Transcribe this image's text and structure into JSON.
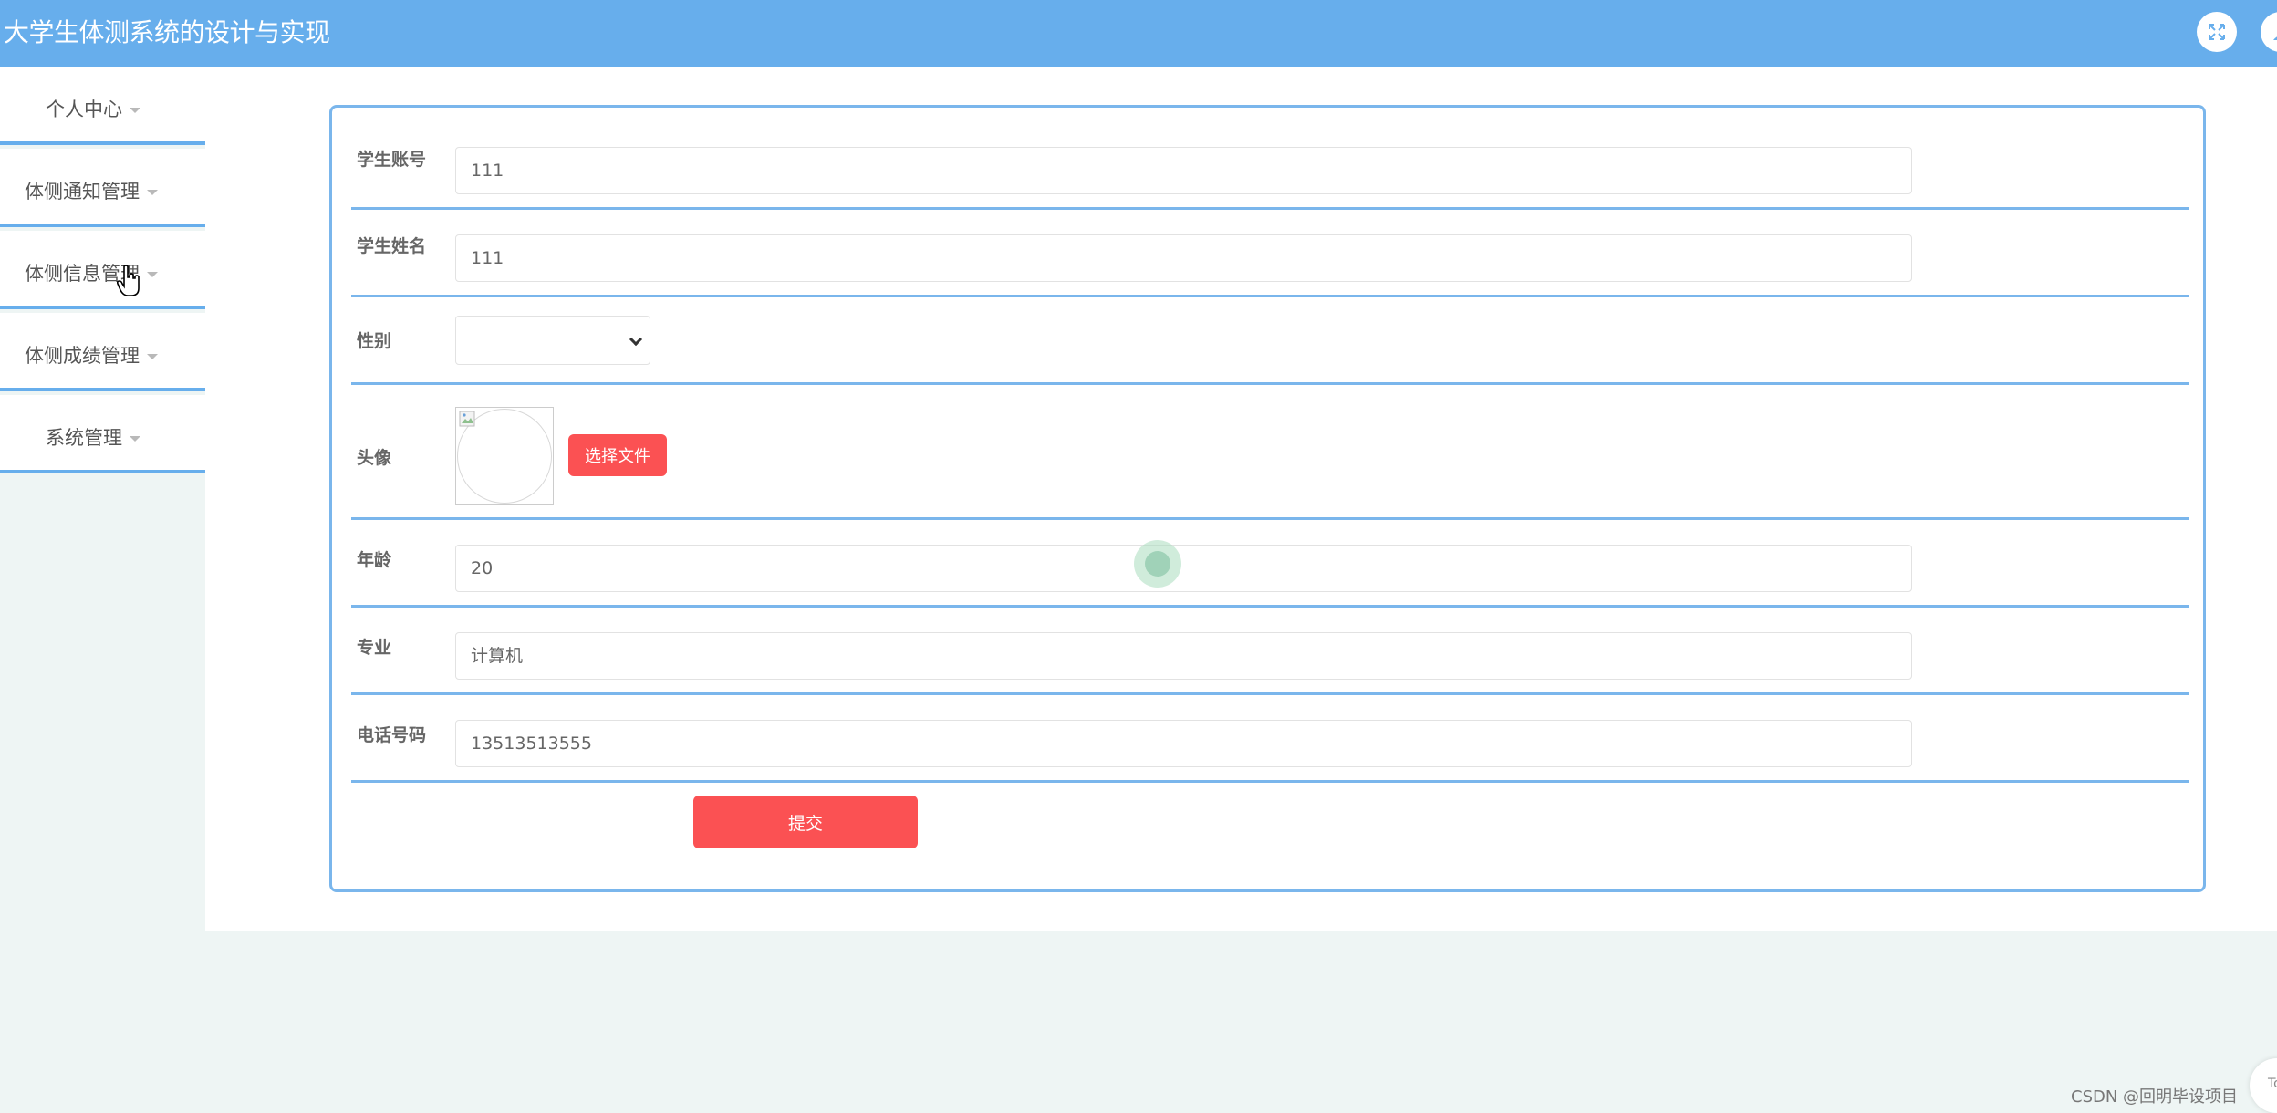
{
  "header": {
    "title": "大学生体测系统的设计与实现",
    "fullscreen_icon": "fullscreen-icon",
    "user_icon": "user-icon",
    "bar_color": "#67aeec"
  },
  "sidebar": {
    "items": [
      {
        "label": "个人中心"
      },
      {
        "label": "体侧通知管理"
      },
      {
        "label": "体侧信息管理"
      },
      {
        "label": "体侧成绩管理"
      },
      {
        "label": "系统管理"
      }
    ]
  },
  "form": {
    "student_account": {
      "label": "学生账号",
      "value": "111"
    },
    "student_name": {
      "label": "学生姓名",
      "value": "111"
    },
    "gender": {
      "label": "性别",
      "value": ""
    },
    "avatar": {
      "label": "头像",
      "button_label": "选择文件"
    },
    "age": {
      "label": "年龄",
      "value": "20"
    },
    "major": {
      "label": "专业",
      "value": "计算机"
    },
    "phone": {
      "label": "电话号码",
      "value": "13513513555"
    },
    "submit_label": "提交"
  },
  "watermark": "CSDN @回明毕设项目",
  "back_to_top_label": "To",
  "colors": {
    "accent": "#67aeec",
    "button": "#fb5153",
    "border": "#7ab6ec"
  }
}
